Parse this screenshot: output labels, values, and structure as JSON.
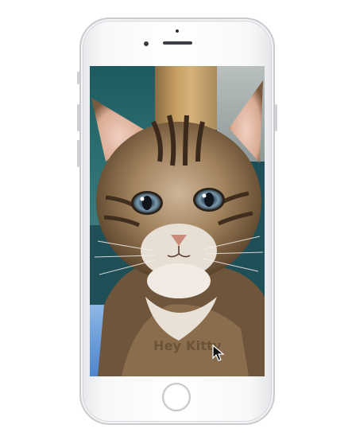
{
  "screen": {
    "caption": "Hey Kitty"
  },
  "icons": {
    "pointer": "mouse-pointer-icon",
    "home": "home-button"
  },
  "colors": {
    "caption": "#6b5338",
    "phone_frame": "#c9cbce",
    "blanket": "#6ea0da"
  }
}
